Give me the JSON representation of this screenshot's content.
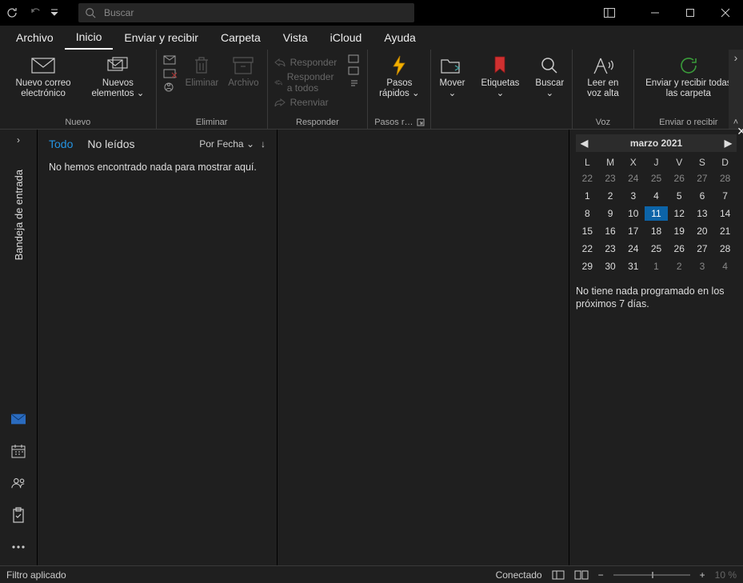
{
  "titlebar": {
    "search_placeholder": "Buscar"
  },
  "tabs": {
    "file": "Archivo",
    "home": "Inicio",
    "sendreceive": "Enviar y recibir",
    "folder": "Carpeta",
    "view": "Vista",
    "icloud": "iCloud",
    "help": "Ayuda"
  },
  "ribbon": {
    "new_mail": "Nuevo correo electrónico",
    "new_items": "Nuevos elementos",
    "group_new": "Nuevo",
    "delete": "Eliminar",
    "archive": "Archivo",
    "group_delete": "Eliminar",
    "reply": "Responder",
    "reply_all": "Responder a todos",
    "forward": "Reenviar",
    "group_respond": "Responder",
    "quick_steps": "Pasos rápidos",
    "group_quick": "Pasos r…",
    "move": "Mover",
    "tags": "Etiquetas",
    "find": "Buscar",
    "read_aloud": "Leer en voz alta",
    "group_voice": "Voz",
    "send_receive_all": "Enviar y recibir todas las carpeta",
    "group_sendrec": "Enviar o recibir"
  },
  "leftbar": {
    "inbox": "Bandeja de entrada"
  },
  "msglist": {
    "all": "Todo",
    "unread": "No leídos",
    "sort": "Por Fecha",
    "empty": "No hemos encontrado nada para mostrar aquí."
  },
  "calendar": {
    "month": "marzo 2021",
    "dow": [
      "L",
      "M",
      "X",
      "J",
      "V",
      "S",
      "D"
    ],
    "days": [
      {
        "n": "22",
        "g": 1
      },
      {
        "n": "23",
        "g": 1
      },
      {
        "n": "24",
        "g": 1
      },
      {
        "n": "25",
        "g": 1
      },
      {
        "n": "26",
        "g": 1
      },
      {
        "n": "27",
        "g": 1
      },
      {
        "n": "28",
        "g": 1
      },
      {
        "n": "1"
      },
      {
        "n": "2"
      },
      {
        "n": "3"
      },
      {
        "n": "4"
      },
      {
        "n": "5"
      },
      {
        "n": "6"
      },
      {
        "n": "7"
      },
      {
        "n": "8"
      },
      {
        "n": "9"
      },
      {
        "n": "10"
      },
      {
        "n": "11",
        "t": 1
      },
      {
        "n": "12"
      },
      {
        "n": "13"
      },
      {
        "n": "14"
      },
      {
        "n": "15"
      },
      {
        "n": "16"
      },
      {
        "n": "17"
      },
      {
        "n": "18"
      },
      {
        "n": "19"
      },
      {
        "n": "20"
      },
      {
        "n": "21"
      },
      {
        "n": "22"
      },
      {
        "n": "23"
      },
      {
        "n": "24"
      },
      {
        "n": "25"
      },
      {
        "n": "26"
      },
      {
        "n": "27"
      },
      {
        "n": "28"
      },
      {
        "n": "29"
      },
      {
        "n": "30"
      },
      {
        "n": "31"
      },
      {
        "n": "1",
        "g": 1
      },
      {
        "n": "2",
        "g": 1
      },
      {
        "n": "3",
        "g": 1
      },
      {
        "n": "4",
        "g": 1
      }
    ],
    "agenda": "No tiene nada programado en los próximos 7 días."
  },
  "status": {
    "filter": "Filtro aplicado",
    "connected": "Conectado",
    "zoom": "10 %"
  }
}
